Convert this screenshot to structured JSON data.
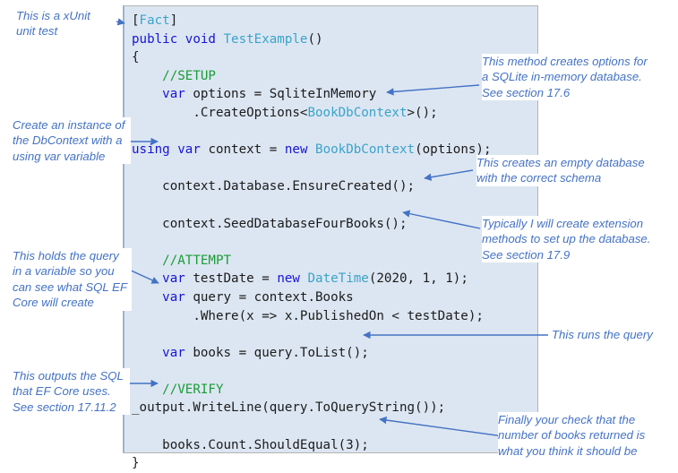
{
  "figure": {
    "kind": "annotated-code-figure",
    "accent_color": "#4472c4",
    "code_bg": "#dce6f2",
    "keyword_color": "#1714d6",
    "type_color": "#3aa3c9",
    "comment_color": "#1a9c35"
  },
  "code": {
    "language": "csharp",
    "lines": [
      "[Fact]",
      "public void TestExample()",
      "{",
      "    //SETUP",
      "    var options = SqliteInMemory",
      "        .CreateOptions<BookDbContext>();",
      "",
      "using var context = new BookDbContext(options);",
      "",
      "    context.Database.EnsureCreated();",
      "",
      "    context.SeedDatabaseFourBooks();",
      "",
      "    //ATTEMPT",
      "    var testDate = new DateTime(2020, 1, 1);",
      "    var query = context.Books",
      "        .Where(x => x.PublishedOn < testDate);",
      "",
      "    var books = query.ToList();",
      "",
      "    //VERIFY",
      "_output.WriteLine(query.ToQueryString());",
      "",
      "    books.Count.ShouldEqual(3);",
      "}"
    ]
  },
  "annotations": {
    "left": [
      {
        "id": "xunit-note",
        "text": "This is a xUnit\nunit test"
      },
      {
        "id": "dbcontext-note",
        "text": "Create an instance of\nthe DbContext with a\nusing var variable"
      },
      {
        "id": "query-variable-note",
        "text": "This holds the query\nin a variable so you\ncan see what SQL EF\nCore will create"
      },
      {
        "id": "output-sql-note",
        "text": "This outputs the SQL\nthat EF Core uses.\nSee section 17.11.2"
      }
    ],
    "right": [
      {
        "id": "sqlite-options-note",
        "text": "This method creates options for\na SQLite in-memory database.\nSee section 17.6"
      },
      {
        "id": "empty-database-note",
        "text": "This creates an empty database\nwith the correct schema"
      },
      {
        "id": "extension-methods-note",
        "text": "Typically I will create extension\nmethods to set up the database.\nSee section 17.9"
      },
      {
        "id": "runs-query-note",
        "text": "This runs the query"
      },
      {
        "id": "final-check-note",
        "text": "Finally your check that the\nnumber of books  returned is\nwhat you think it should be"
      }
    ]
  }
}
